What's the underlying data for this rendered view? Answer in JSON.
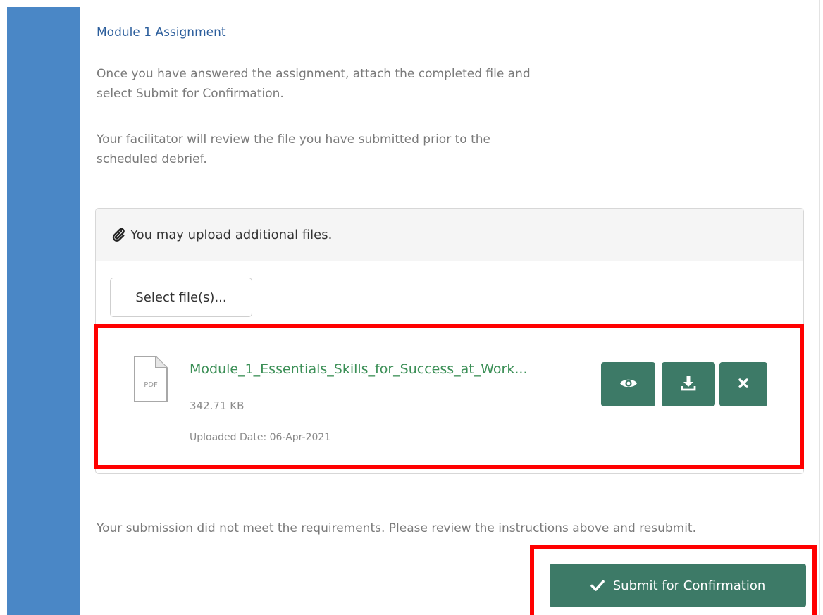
{
  "assignment": {
    "title": "Module 1 Assignment",
    "instructions": "Once you have answered the assignment, attach the completed file and select Submit for Confirmation.",
    "review_note": "Your facilitator will review the file you have submitted prior to the scheduled debrief."
  },
  "upload": {
    "header_text": "You may upload additional files.",
    "header_icon": "paperclip-icon",
    "select_button_label": "Select file(s)..."
  },
  "file": {
    "name": "Module_1_Essentials_Skills_for_Success_at_Work...",
    "size": "342.71 KB",
    "uploaded_date": "Uploaded Date: 06-Apr-2021",
    "type_label": "PDF",
    "actions": {
      "view_icon": "eye-icon",
      "download_icon": "download-icon",
      "remove_icon": "close-icon"
    }
  },
  "status_message": "Your submission did not meet the requirements. Please review the instructions above and resubmit.",
  "submit_button_label": "Submit for Confirmation",
  "colors": {
    "sidebar": "#4a87c6",
    "title": "#2c5e9c",
    "accent_button": "#3d7a67",
    "file_link": "#3b8f56",
    "highlight": "#ff0000"
  }
}
